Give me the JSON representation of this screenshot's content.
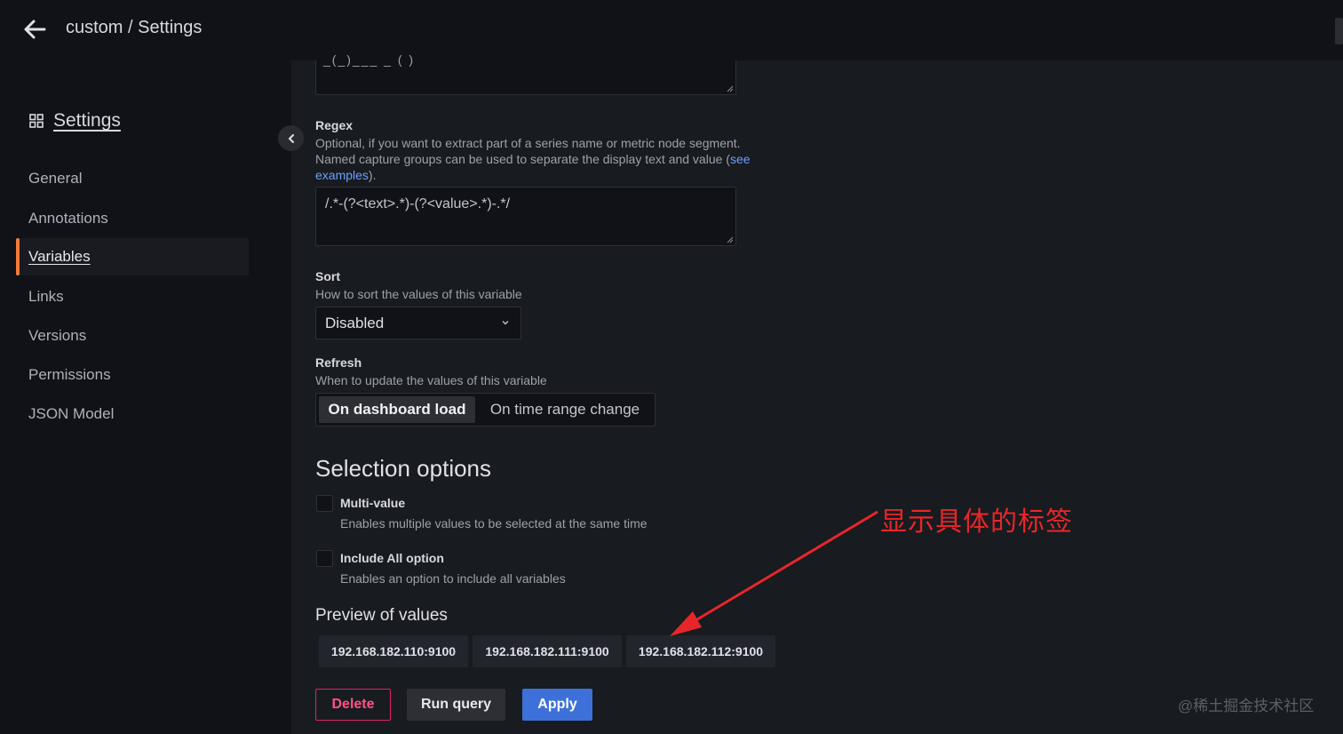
{
  "header": {
    "folder": "custom",
    "separator": " / ",
    "page": "Settings"
  },
  "sidebar": {
    "title": "Settings",
    "items": [
      {
        "label": "General"
      },
      {
        "label": "Annotations"
      },
      {
        "label": "Variables",
        "active": true
      },
      {
        "label": "Links"
      },
      {
        "label": "Versions"
      },
      {
        "label": "Permissions"
      },
      {
        "label": "JSON Model"
      }
    ]
  },
  "query_textarea": {
    "clipped_value": "_(_)___ _ ( )"
  },
  "regex": {
    "label": "Regex",
    "desc_line1": "Optional, if you want to extract part of a series name or metric node segment.",
    "desc_line2": "Named capture groups can be used to separate the display text and value (",
    "link_part1": "see",
    "link_part2": "examples",
    "desc_end": ").",
    "value": "/.*-(?<text>.*)-(?<value>.*)-.*/"
  },
  "sort": {
    "label": "Sort",
    "desc": "How to sort the values of this variable",
    "value": "Disabled"
  },
  "refresh": {
    "label": "Refresh",
    "desc": "When to update the values of this variable",
    "options": [
      "On dashboard load",
      "On time range change"
    ],
    "selected": "On dashboard load"
  },
  "selection": {
    "title": "Selection options",
    "multi_value": {
      "label": "Multi-value",
      "desc": "Enables multiple values to be selected at the same time",
      "checked": false
    },
    "include_all": {
      "label": "Include All option",
      "desc": "Enables an option to include all variables",
      "checked": false
    }
  },
  "preview": {
    "title": "Preview of values",
    "values": [
      "192.168.182.110:9100",
      "192.168.182.111:9100",
      "192.168.182.112:9100"
    ]
  },
  "actions": {
    "delete": "Delete",
    "run_query": "Run query",
    "apply": "Apply"
  },
  "annotation": {
    "text": "显示具体的标签",
    "color": "#e8262a"
  },
  "watermark": "@稀土掘金技术社区",
  "colors": {
    "accent_active": "#f27a3a",
    "primary": "#3d71d9",
    "danger": "#e0226e",
    "link": "#6e9fff"
  }
}
